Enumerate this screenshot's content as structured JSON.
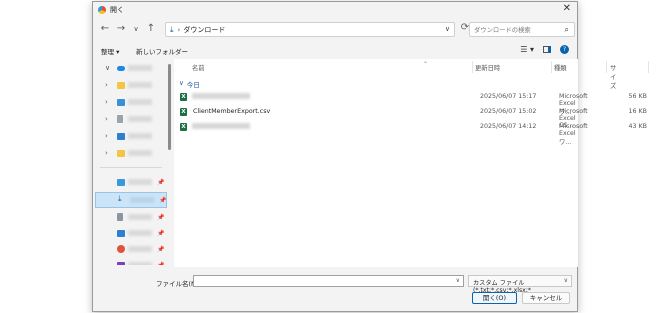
{
  "window": {
    "title": "開く",
    "close_glyph": "✕"
  },
  "nav": {
    "back_glyph": "←",
    "forward_glyph": "→",
    "dropdown_glyph": "∨",
    "up_glyph": "↑",
    "address_separator": "›",
    "address_folder": "ダウンロード",
    "address_chevron": "∨",
    "refresh_glyph": "⟳",
    "search_placeholder": "ダウンロードの検索",
    "search_glyph": "⌕"
  },
  "commands": {
    "organize_label": "整理 ▾",
    "new_folder_label": "新しいフォルダー",
    "view_glyph": "☰ ▾",
    "help_glyph": "?"
  },
  "columns": {
    "name": "名前",
    "modified": "更新日時",
    "type": "種類",
    "size": "サイズ",
    "sort_glyph": "⌄"
  },
  "group": {
    "label": "今日",
    "chevron": "∨"
  },
  "files": [
    {
      "name": "",
      "modified": "2025/06/07 15:17",
      "type": "Microsoft Excel ワ...",
      "size": "56 KB",
      "icon": "excel-icon"
    },
    {
      "name": "ClientMemberExport.csv",
      "modified": "2025/06/07 15:02",
      "type": "Microsoft Excel CS...",
      "size": "16 KB",
      "icon": "excel-csv-icon"
    },
    {
      "name": "",
      "modified": "2025/06/07 14:12",
      "type": "Microsoft Excel ワ...",
      "size": "43 KB",
      "icon": "excel-icon"
    }
  ],
  "sidebar_icons": [
    "onedrive-icon",
    "folder-icon",
    "folder-icon",
    "document-icon",
    "pictures-icon",
    "folder-icon",
    "desktop-icon",
    "download-icon",
    "document-icon",
    "pictures-icon",
    "music-icon",
    "video-icon"
  ],
  "bottom": {
    "filename_label": "ファイル名(N):",
    "filename_value": "",
    "filter_text": "カスタム ファイル (*.txt;*.csv;*.xlsx;*",
    "open_label": "開く(O)",
    "cancel_label": "キャンセル",
    "chevron": "∨"
  },
  "tree_glyphs": {
    "expanded": "∨",
    "collapsed": "›",
    "pin": "📌"
  },
  "colors": {
    "accent": "#0a64ad",
    "excel_green": "#1d7044",
    "selection": "#cce4f7"
  }
}
